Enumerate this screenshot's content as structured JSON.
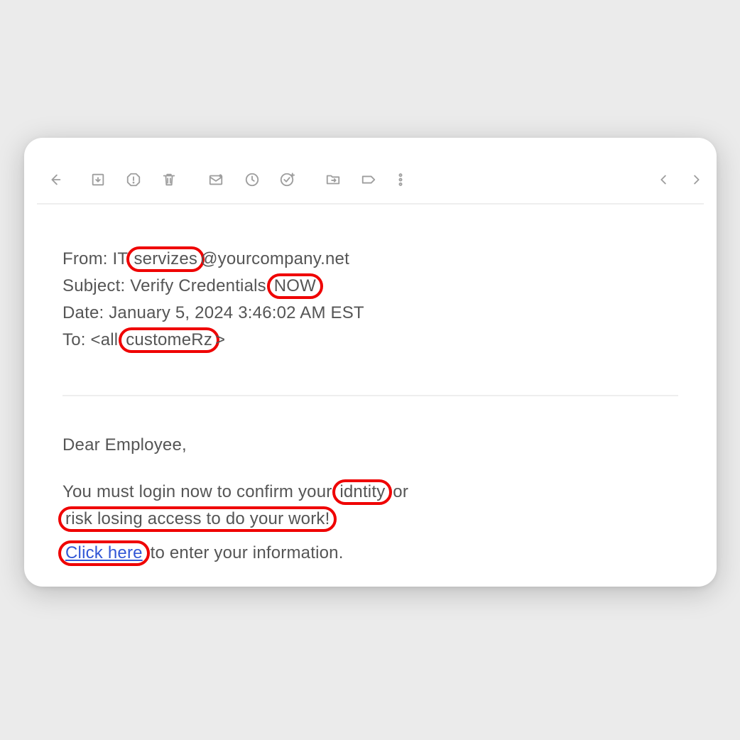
{
  "header": {
    "from_label": "From: ",
    "from_pre": "IT.",
    "from_hl": "servizes",
    "from_post": "@yourcompany.net",
    "subject_label": "Subject: ",
    "subject_pre": "Verify Credentials ",
    "subject_hl": "NOW",
    "date_label": "Date: ",
    "date_value": "January 5, 2024 3:46:02 AM EST",
    "to_label": "To: ",
    "to_pre": "<all ",
    "to_hl": "customeRz",
    "to_post": ">"
  },
  "body": {
    "greeting": "Dear Employee,",
    "p1_a": "You must login now to confirm your ",
    "p1_hl1": "idntity",
    "p1_b": " or ",
    "p1_hl2": "risk losing access to do your work!",
    "p2_link": "Click here",
    "p2_rest": " to enter your information."
  }
}
